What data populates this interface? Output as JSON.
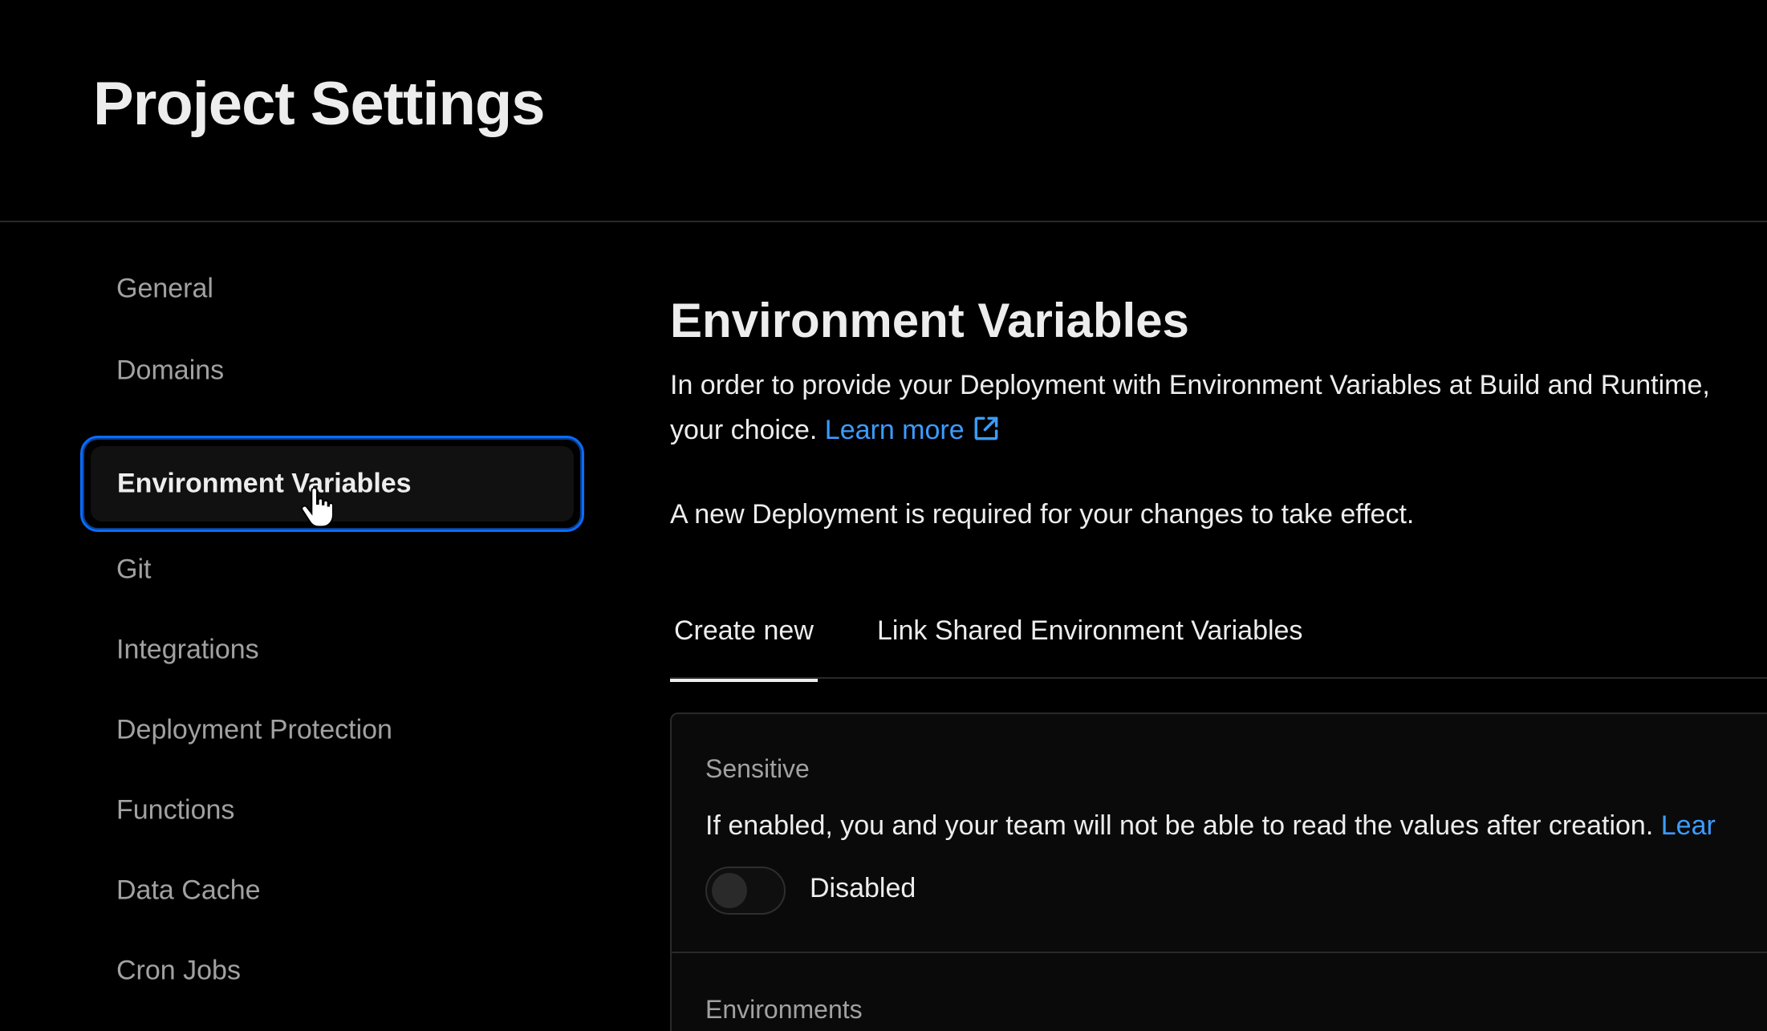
{
  "header": {
    "title": "Project Settings"
  },
  "sidebar": {
    "items": [
      {
        "label": "General"
      },
      {
        "label": "Domains"
      },
      {
        "label": "Environment Variables"
      },
      {
        "label": "Git"
      },
      {
        "label": "Integrations"
      },
      {
        "label": "Deployment Protection"
      },
      {
        "label": "Functions"
      },
      {
        "label": "Data Cache"
      },
      {
        "label": "Cron Jobs"
      }
    ],
    "active_index": 2
  },
  "main": {
    "title": "Environment Variables",
    "description_part1": "In order to provide your Deployment with Environment Variables at Build and Runtime,",
    "description_part2": "your choice.",
    "learn_more": "Learn more",
    "notice": "A new Deployment is required for your changes to take effect.",
    "tabs": [
      {
        "label": "Create new"
      },
      {
        "label": "Link Shared Environment Variables"
      }
    ],
    "card": {
      "sensitive_label": "Sensitive",
      "sensitive_desc": "If enabled, you and your team will not be able to read the values after creation.",
      "sensitive_link": "Lear",
      "toggle_label": "Disabled",
      "environments_label": "Environments"
    }
  },
  "colors": {
    "background": "#000000",
    "accent_blue": "#0a6cff",
    "link_blue": "#3b9cff",
    "text_primary": "#ededed",
    "text_muted": "#a1a1a1"
  },
  "icons": {
    "external_link": "external-link-icon",
    "cursor": "hand-pointer-icon"
  }
}
